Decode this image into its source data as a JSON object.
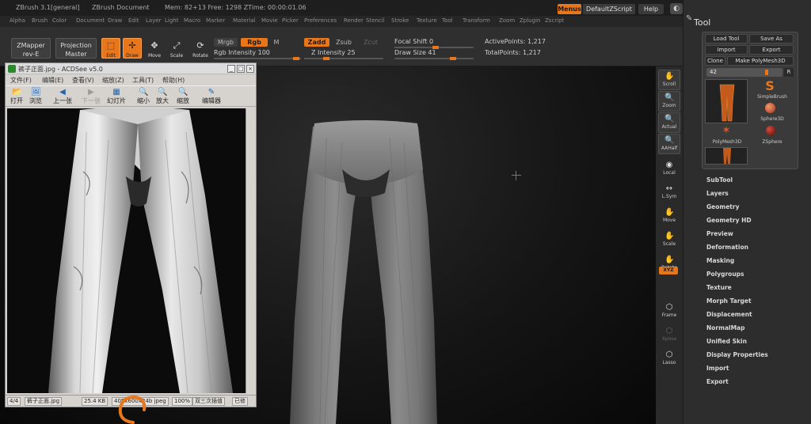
{
  "app": {
    "name": "ZBrush 3.1[general]",
    "document": "ZBrush Document",
    "stats": "Mem: 82+13  Free: 1298  ZTime: 00:00:01.06",
    "menus_label": "Menus",
    "default_zscript": "DefaultZScript",
    "help": "Help"
  },
  "menubar": [
    "Alpha",
    "Brush",
    "Color",
    "Document",
    "Draw",
    "Edit",
    "Layer",
    "Light",
    "Macro",
    "Marker",
    "Material",
    "Movie",
    "Picker",
    "Preferences",
    "Render",
    "Stencil",
    "Stroke",
    "Texture",
    "Tool",
    "Transform",
    "Zoom",
    "Zplugin",
    "Zscript"
  ],
  "toolbar": {
    "zmapper": [
      "ZMapper",
      "rev-E"
    ],
    "projection": [
      "Projection",
      "Master"
    ],
    "edit": "Edit",
    "draw": "Draw",
    "move": "Move",
    "scale": "Scale",
    "rotate": "Rotate",
    "mrgb": "Mrgb",
    "rgb": "Rgb",
    "m": "M",
    "rgb_intensity": "Rgb Intensity 100",
    "zadd": "Zadd",
    "zsub": "Zsub",
    "zcut": "Zcut",
    "z_intensity": "Z Intensity 25",
    "focal_shift": "Focal Shift 0",
    "draw_size": "Draw Size 41",
    "active_points": "ActivePoints: 1,217",
    "total_points": "TotalPoints: 1,217"
  },
  "shelf": [
    {
      "label": "Scroll",
      "icon": "✋"
    },
    {
      "label": "Zoom",
      "icon": "🔍"
    },
    {
      "label": "Actual",
      "icon": "🔍"
    },
    {
      "label": "AAHalf",
      "icon": "🔍"
    },
    {
      "label": "Local",
      "icon": "◉"
    },
    {
      "label": "L.Sym",
      "icon": "↔"
    },
    {
      "label": "Move",
      "icon": "✋"
    },
    {
      "label": "Scale",
      "icon": "✋"
    },
    {
      "label": "Rotate",
      "icon": "✋"
    },
    {
      "label": "Frame",
      "icon": "⬡"
    },
    {
      "label": "Xpose",
      "icon": "⬡"
    },
    {
      "label": "Lasso",
      "icon": "⬡"
    }
  ],
  "xyz_label": "XYZ",
  "tool_palette": {
    "title": "Tool",
    "load_tool": "Load Tool",
    "save_as": "Save As",
    "import": "Import",
    "export": "Export",
    "clone": "Clone",
    "make_polymesh": "Make PolyMesh3D",
    "number": "42",
    "r": "R",
    "thumbs": [
      "SimpleBrush",
      "Sphere3D",
      "PolyMesh3D",
      "ZSphere"
    ],
    "sections": [
      "SubTool",
      "Layers",
      "Geometry",
      "Geometry HD",
      "Preview",
      "Deformation",
      "Masking",
      "Polygroups",
      "Texture",
      "Morph Target",
      "Displacement",
      "NormalMap",
      "Unified Skin",
      "Display Properties",
      "Import",
      "Export"
    ]
  },
  "acdsee": {
    "title": "裤子正面.jpg - ACDSee v5.0",
    "menu": [
      "文件(F)",
      "编辑(E)",
      "查看(V)",
      "缩放(Z)",
      "工具(T)",
      "帮助(H)"
    ],
    "tools": [
      {
        "label": "打开",
        "icon": "📂",
        "enabled": true
      },
      {
        "label": "浏览",
        "icon": "🖼",
        "enabled": true
      },
      {
        "label": "上一张",
        "icon": "◀",
        "enabled": true
      },
      {
        "label": "下一张",
        "icon": "▶",
        "enabled": false
      },
      {
        "label": "幻灯片",
        "icon": "▦",
        "enabled": true
      },
      {
        "label": "缩小",
        "icon": "🔍",
        "enabled": true
      },
      {
        "label": "放大",
        "icon": "🔍",
        "enabled": true
      },
      {
        "label": "缩放",
        "icon": "🔍",
        "enabled": true
      },
      {
        "label": "编辑器",
        "icon": "✎",
        "enabled": true
      }
    ],
    "status": [
      "4/4",
      "裤子正面.jpg",
      "25.4 KB",
      "405x600x24b jpeg",
      "100%",
      "双三次插值",
      "已修"
    ]
  },
  "colors": {
    "accent": "#e8761b",
    "panel": "#2d2d2d"
  }
}
